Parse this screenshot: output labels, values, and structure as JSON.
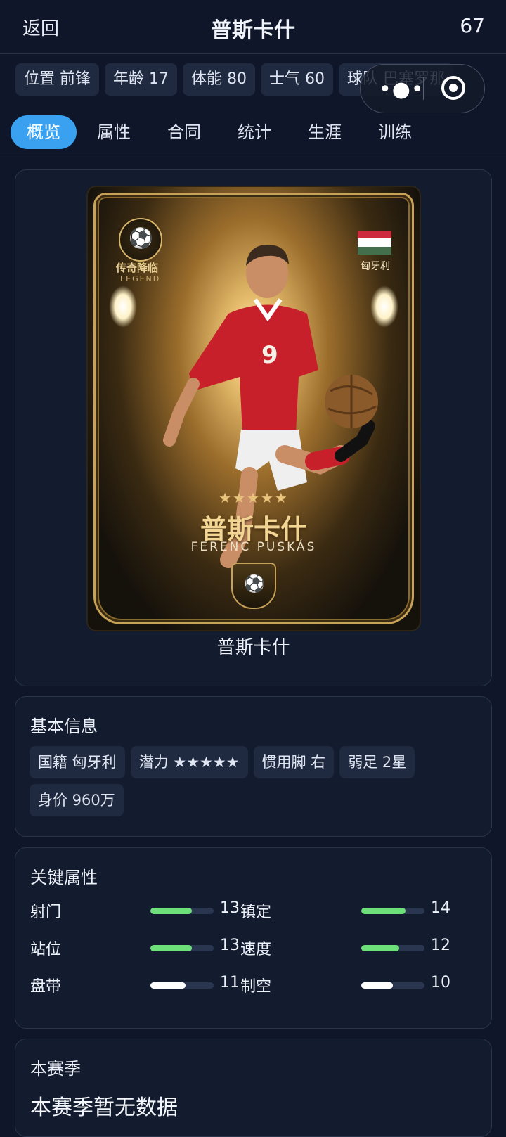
{
  "header": {
    "back_label": "返回",
    "title": "普斯卡什",
    "rating": "67"
  },
  "info_chips": [
    "位置 前锋",
    "年龄 17",
    "体能 80",
    "士气 60",
    "球队 巴塞罗那"
  ],
  "tabs": [
    {
      "label": "概览",
      "active": true
    },
    {
      "label": "属性",
      "active": false
    },
    {
      "label": "合同",
      "active": false
    },
    {
      "label": "统计",
      "active": false
    },
    {
      "label": "生涯",
      "active": false
    },
    {
      "label": "训练",
      "active": false
    }
  ],
  "capsule": {
    "more_icon": "more-dots-icon",
    "close_icon": "target-close-icon"
  },
  "player_card": {
    "legend_cn": "传奇降临",
    "legend_en": "LEGEND",
    "nation": "匈牙利",
    "flag_colors": [
      "#cd2a3e",
      "#ffffff",
      "#436f4d"
    ],
    "stars": "★★★★★",
    "name_cn": "普斯卡什",
    "name_en": "FERENC PUSKÁS",
    "shirt_number": "9"
  },
  "hero_name": "普斯卡什",
  "basic_info": {
    "title": "基本信息",
    "tags": [
      "国籍 匈牙利",
      "潜力 ★★★★★",
      "惯用脚 右",
      "弱足 2星",
      "身价 960万"
    ]
  },
  "key_attributes": {
    "title": "关键属性",
    "rows": [
      [
        {
          "label": "射门",
          "value": "13",
          "fill": 0.65,
          "color": "#6ee07a"
        },
        {
          "label": "镇定",
          "value": "14",
          "fill": 0.7,
          "color": "#6ee07a"
        }
      ],
      [
        {
          "label": "站位",
          "value": "13",
          "fill": 0.65,
          "color": "#6ee07a"
        },
        {
          "label": "速度",
          "value": "12",
          "fill": 0.6,
          "color": "#6ee07a"
        }
      ],
      [
        {
          "label": "盘带",
          "value": "11",
          "fill": 0.55,
          "color": "#ffffff"
        },
        {
          "label": "制空",
          "value": "10",
          "fill": 0.5,
          "color": "#ffffff"
        }
      ]
    ]
  },
  "season": {
    "title": "本赛季",
    "empty_text": "本赛季暂无数据"
  },
  "colors": {
    "background": "#0f1629",
    "card": "#131b2e",
    "chip": "#1f2a40",
    "accent": "#3aa1f0"
  }
}
